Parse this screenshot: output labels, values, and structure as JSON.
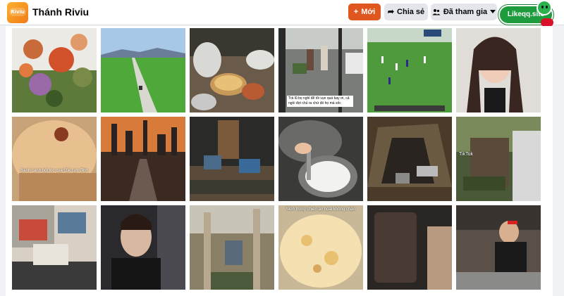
{
  "header": {
    "group_name": "Thánh Riviu",
    "buttons": {
      "new_label": "Mới",
      "share_label": "Chia sẻ",
      "joined_label": "Đã tham gia"
    }
  },
  "badge": {
    "label": "Likeqq.site"
  },
  "photos": {
    "row1": [
      {
        "name": "flowers"
      },
      {
        "name": "rice-field-road"
      },
      {
        "name": "food-table"
      },
      {
        "name": "street-scene",
        "caption": "Trả lũ bọ nghỉ để tôi vụn quá bay ơi, cả ngồi đợi chủ ra chứ đó họ mà sốc"
      },
      {
        "name": "football-field"
      },
      {
        "name": "woman-phone"
      }
    ],
    "row2": [
      {
        "name": "noodle-soup",
        "caption": "Bánh canh bột lọc cua 55k cực đỉnh"
      },
      {
        "name": "city-sunset"
      },
      {
        "name": "night-vendor"
      },
      {
        "name": "cooking-pot"
      },
      {
        "name": "camping-tent"
      },
      {
        "name": "tiktok-video",
        "tiktok": "TikTok"
      }
    ],
    "row3": [
      {
        "name": "shop-counter"
      },
      {
        "name": "man-car"
      },
      {
        "name": "outdoor-work"
      },
      {
        "name": "fried-egg",
        "caption": "Món trứng chiên ăn hoài không chán"
      },
      {
        "name": "dark-phone"
      },
      {
        "name": "chef-kitchen"
      }
    ]
  }
}
